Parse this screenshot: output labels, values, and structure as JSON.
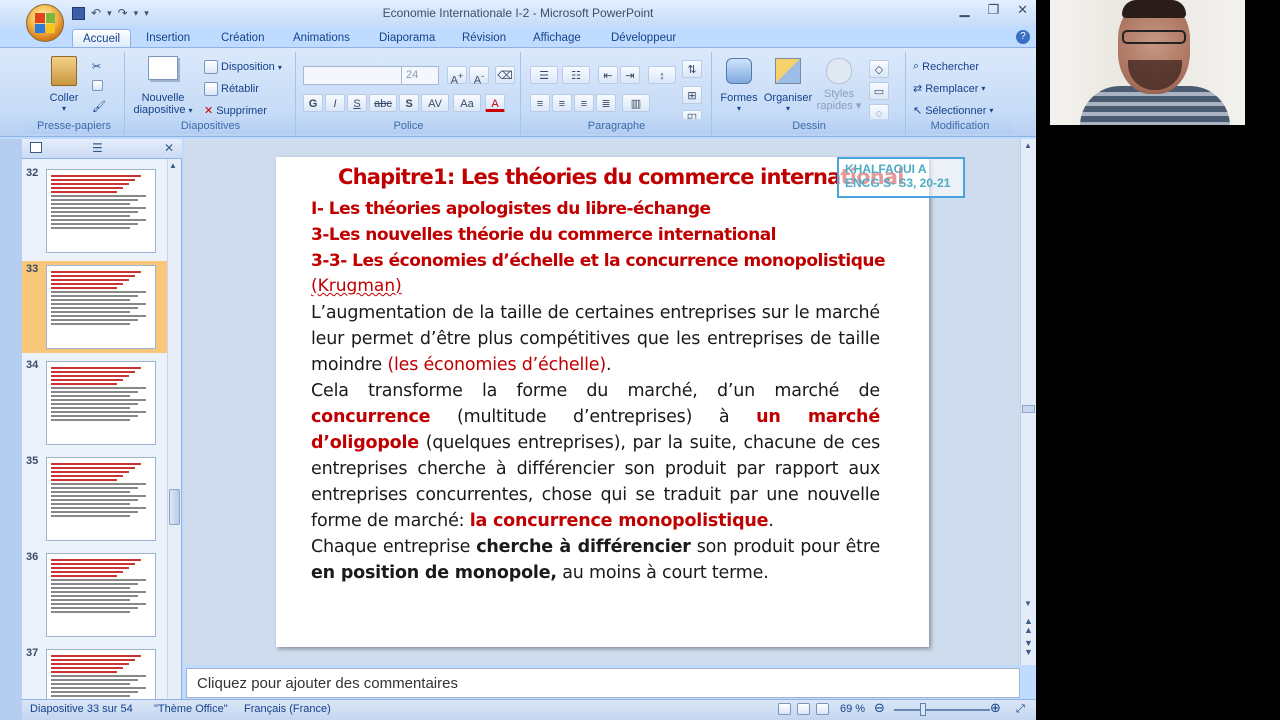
{
  "window": {
    "title": "Economie Internationale I-2 - Microsoft PowerPoint",
    "controls": {
      "minimize": "▁",
      "maximize": "❐",
      "close": "✕"
    }
  },
  "qat": {
    "save_icon": "save-icon",
    "undo": "↶",
    "redo": "↷"
  },
  "tabs": [
    "Accueil",
    "Insertion",
    "Création",
    "Animations",
    "Diaporama",
    "Révision",
    "Affichage",
    "Développeur"
  ],
  "ribbon": {
    "clipboard": {
      "label": "Presse-papiers",
      "paste": "Coller"
    },
    "slides": {
      "label": "Diapositives",
      "new_slide": "Nouvelle",
      "new_slide2": "diapositive",
      "layout": "Disposition",
      "reset": "Rétablir",
      "delete": "Supprimer"
    },
    "font": {
      "label": "Police",
      "size": "24",
      "bold": "G",
      "italic": "I",
      "underline": "S",
      "strike": "abc",
      "shadow": "S",
      "spacing": "AV",
      "case": "Aa",
      "color": "A"
    },
    "paragraph": {
      "label": "Paragraphe"
    },
    "drawing": {
      "label": "Dessin",
      "shapes": "Formes",
      "arrange": "Organiser",
      "quick_styles": "Styles",
      "quick_styles2": "rapides"
    },
    "editing": {
      "label": "Modification",
      "find": "Rechercher",
      "replace": "Remplacer",
      "select": "Sélectionner"
    }
  },
  "thumbnails": [
    {
      "num": "32",
      "selected": false
    },
    {
      "num": "33",
      "selected": true
    },
    {
      "num": "34",
      "selected": false
    },
    {
      "num": "35",
      "selected": false
    },
    {
      "num": "36",
      "selected": false
    },
    {
      "num": "37",
      "selected": false
    }
  ],
  "slide": {
    "title": "Chapitre1: Les théories du commerce international",
    "h1": "I- Les théories apologistes du libre-échange",
    "h2": "3-Les nouvelles théorie du commerce international",
    "h3": "3-3- Les économies d’échelle et la concurrence monopolistique",
    "krugman": "(Krugman)",
    "p1_a": "L’augmentation de la taille de certaines entreprises sur le marché leur permet d’être plus compétitives que les entreprises de taille moindre ",
    "p1_red": "(les économies d’échelle)",
    "p1_end": ".",
    "p2_a": "Cela transforme la forme du marché, d’un marché de ",
    "p2_red1": "concurrence",
    "p2_b": " (multitude d’entreprises) à ",
    "p2_red2": "un marché d’oligopole",
    "p2_c": " (quelques entreprises), par la suite, chacune de ces entreprises cherche à différencier son produit par rapport aux entreprises concurrentes, chose qui se traduit par une nouvelle forme de marché: ",
    "p2_red3": "la concurrence monopolistique",
    "p2_end": ".",
    "p3_a": "Chaque entreprise ",
    "p3_bold1": "cherche à différencier",
    "p3_b": " son produit pour être ",
    "p3_bold2": "en position de monopole,",
    "p3_c": " au moins à court terme."
  },
  "author_box": {
    "line1": "KHALFAOUI A",
    "line2": "ENCG S- S3, 20-21"
  },
  "notes_placeholder": "Cliquez pour ajouter des commentaires",
  "status": {
    "slide_info": "Diapositive 33 sur 54",
    "theme": "\"Thème Office\"",
    "language": "Français (France)",
    "zoom": "69 %"
  },
  "colors": {
    "accent_red": "#c00000",
    "ribbon_blue": "#15428b",
    "selected_thumb": "#f9c77a"
  }
}
